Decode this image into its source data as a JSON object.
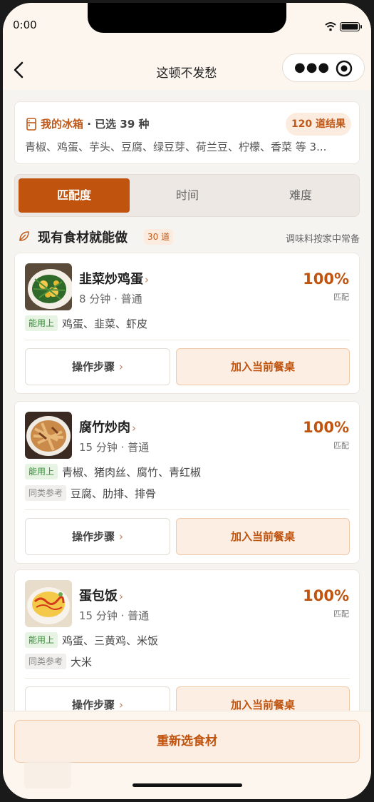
{
  "status_bar": {
    "time": "0:00"
  },
  "nav": {
    "title": "这顿不发愁"
  },
  "fridge": {
    "label": "我的冰箱",
    "selected": " · 已选 39 种",
    "results": "120 道结果",
    "items": "青椒、鸡蛋、芋头、豆腐、绿豆芽、荷兰豆、柠檬、香菜 等 3..."
  },
  "tabs": [
    "匹配度",
    "时间",
    "难度"
  ],
  "section": {
    "title": "现有食材就能做",
    "count": "30 道",
    "note": "调味料按家中常备"
  },
  "recipes": [
    {
      "name": "韭菜炒鸡蛋",
      "meta": "8 分钟 · 普通",
      "match": "100%",
      "match_label": "匹配",
      "can_use_label": "能用上",
      "can_use": "鸡蛋、韭菜、虾皮",
      "steps_label": "操作步骤",
      "add_label": "加入当前餐桌"
    },
    {
      "name": "腐竹炒肉",
      "meta": "15 分钟 · 普通",
      "match": "100%",
      "match_label": "匹配",
      "can_use_label": "能用上",
      "can_use": "青椒、猪肉丝、腐竹、青红椒",
      "similar_label": "同类参考",
      "similar": "豆腐、肋排、排骨",
      "steps_label": "操作步骤",
      "add_label": "加入当前餐桌"
    },
    {
      "name": "蛋包饭",
      "meta": "15 分钟 · 普通",
      "match": "100%",
      "match_label": "匹配",
      "can_use_label": "能用上",
      "can_use": "鸡蛋、三黄鸡、米饭",
      "similar_label": "同类参考",
      "similar": "大米",
      "steps_label": "操作步骤",
      "add_label": "加入当前餐桌"
    }
  ],
  "bottom": {
    "reselect": "重新选食材"
  },
  "colors": {
    "accent": "#c0540f",
    "accent_light": "#fdeee3",
    "green_tag": "#3c8a3c",
    "header_bg": "#fdf6ee"
  },
  "icons": [
    "back-arrow-icon",
    "more-dots-icon",
    "target-icon",
    "fridge-icon",
    "leaf-icon",
    "chevron-right-icon",
    "wifi-icon",
    "battery-icon"
  ]
}
